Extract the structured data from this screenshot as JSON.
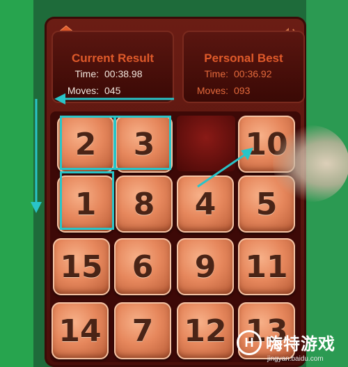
{
  "current": {
    "title": "Current Result",
    "time_label": "Time:",
    "time_value": "00:38.98",
    "moves_label": "Moves:",
    "moves_value": "045"
  },
  "best": {
    "title": "Personal Best",
    "time_label": "Time:",
    "time_value": "00:36.92",
    "moves_label": "Moves:",
    "moves_value": "093"
  },
  "tiles": [
    "2",
    "3",
    "10",
    "1",
    "8",
    "4",
    "5",
    "15",
    "6",
    "9",
    "11",
    "14",
    "7",
    "12",
    "13"
  ],
  "watermark": {
    "logo": "H",
    "title": "嗨特游戏",
    "sub": "jingyan.baidu.com"
  },
  "colors": {
    "highlight": "#29c4c8",
    "title_red": "#e05a2a"
  },
  "icons": {
    "home": "home-icon",
    "sound": "sound-icon"
  }
}
